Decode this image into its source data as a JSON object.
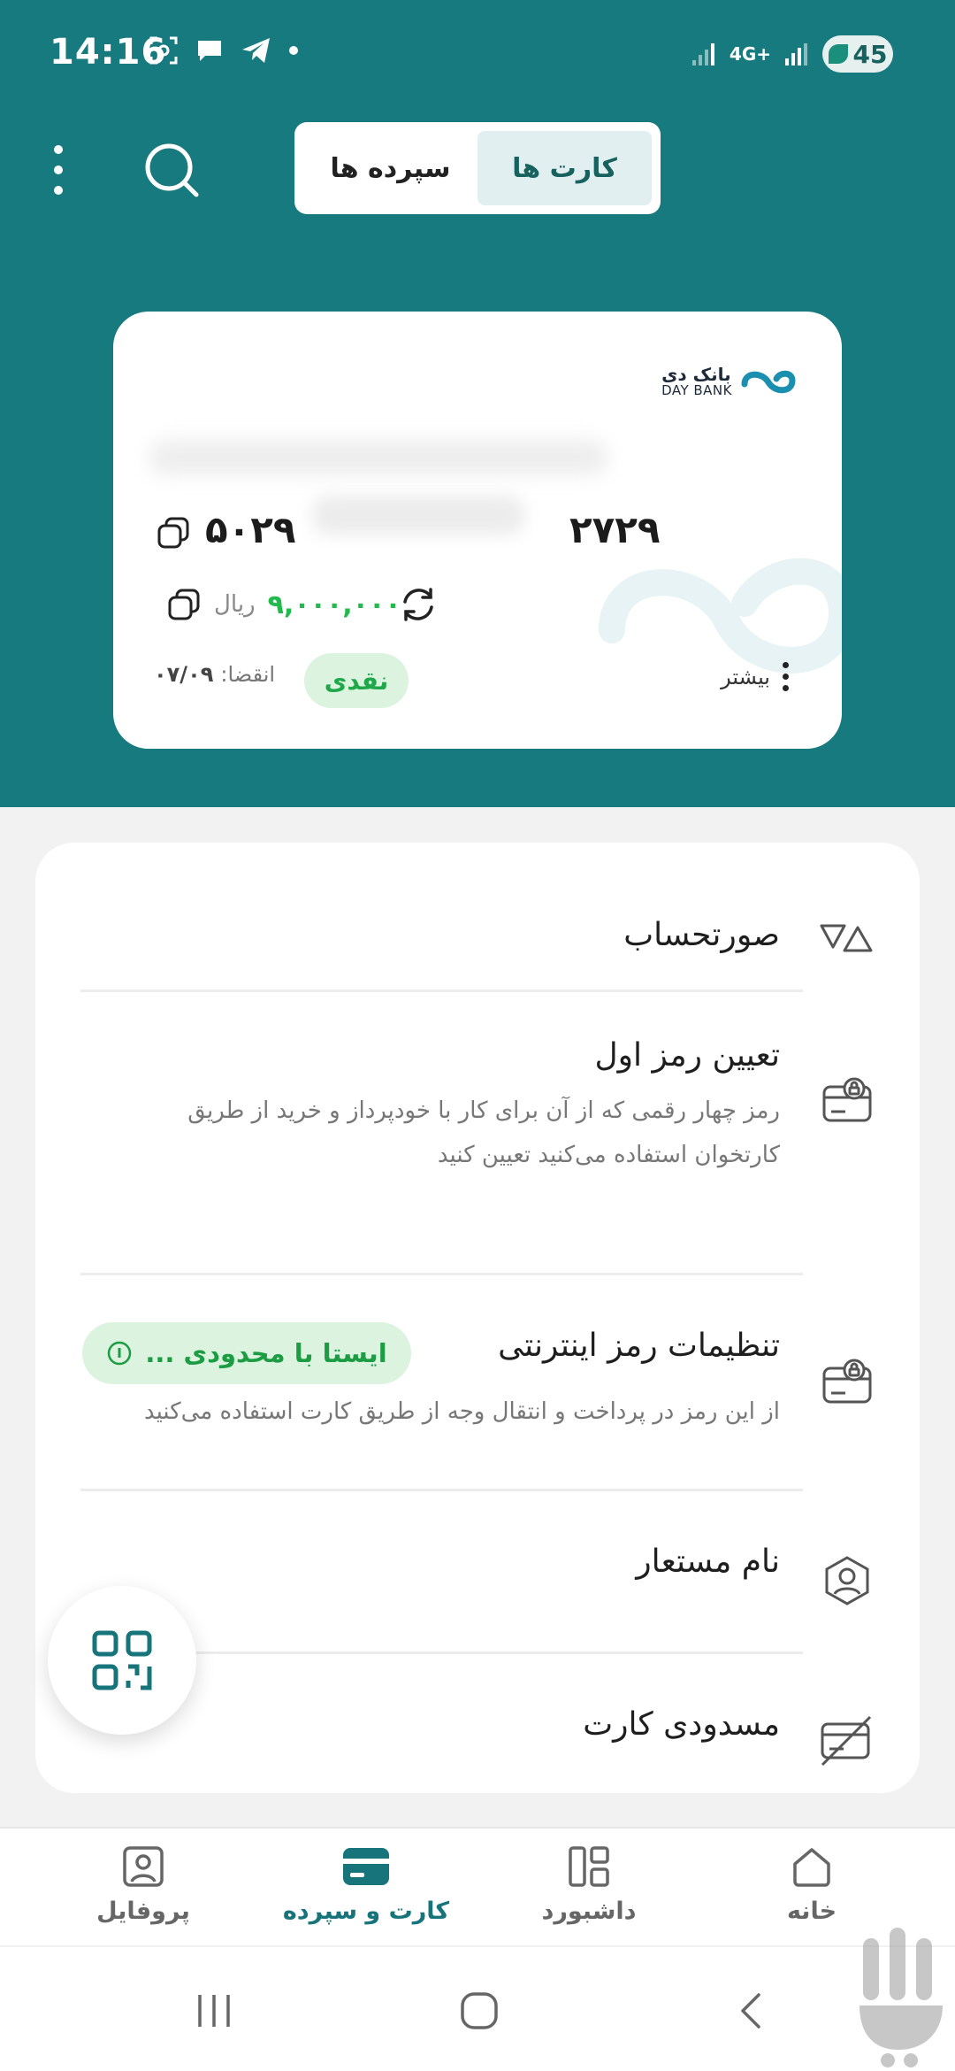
{
  "status_bar": {
    "time": "14:16",
    "network": "4G+",
    "battery": "45"
  },
  "top_bar": {
    "tabs": [
      {
        "label": "کارت ها",
        "active": true
      },
      {
        "label": "سپرده ها",
        "active": false
      }
    ]
  },
  "card": {
    "bank_name_fa": "بانک دی",
    "bank_name_en": "DAY BANK",
    "number_last": "۵۰۲۹",
    "number_first": "۲۷۲۹",
    "balance": "۹,۰۰۰,۰۰۰",
    "currency": "ریال",
    "type": "نقدی",
    "expiry_label": "انقضا:",
    "expiry_value": "۰۷/۰۹",
    "more_label": "بیشتر"
  },
  "options": [
    {
      "title": "صورتحساب",
      "icon": "statement-icon"
    },
    {
      "title": "تعیین رمز اول",
      "description": "رمز چهار رقمی که از آن برای کار با خودپرداز و خرید از طریق کارتخوان استفاده می‌کنید تعیین کنید",
      "icon": "card-lock-icon"
    },
    {
      "title": "تنظیمات رمز اینترنتی",
      "description": "از این رمز در پرداخت و انتقال وجه از طریق کارت استفاده می‌کنید",
      "status": "ایستا با محدودی ...",
      "icon": "card-lock-icon"
    },
    {
      "title": "نام مستعار",
      "icon": "user-icon"
    },
    {
      "title": "مسدودی کارت",
      "icon": "card-blocked-icon"
    }
  ],
  "bottom_nav": [
    {
      "label": "خانه",
      "icon": "home-icon",
      "active": false
    },
    {
      "label": "داشبورد",
      "icon": "dashboard-icon",
      "active": false
    },
    {
      "label": "کارت و سپرده",
      "icon": "card-icon",
      "active": true
    },
    {
      "label": "پروفایل",
      "icon": "profile-icon",
      "active": false
    }
  ],
  "colors": {
    "primary": "#177a7f",
    "accent_green": "#22b94d",
    "badge_bg": "#dcf3e0",
    "background": "#f2f2f2"
  }
}
